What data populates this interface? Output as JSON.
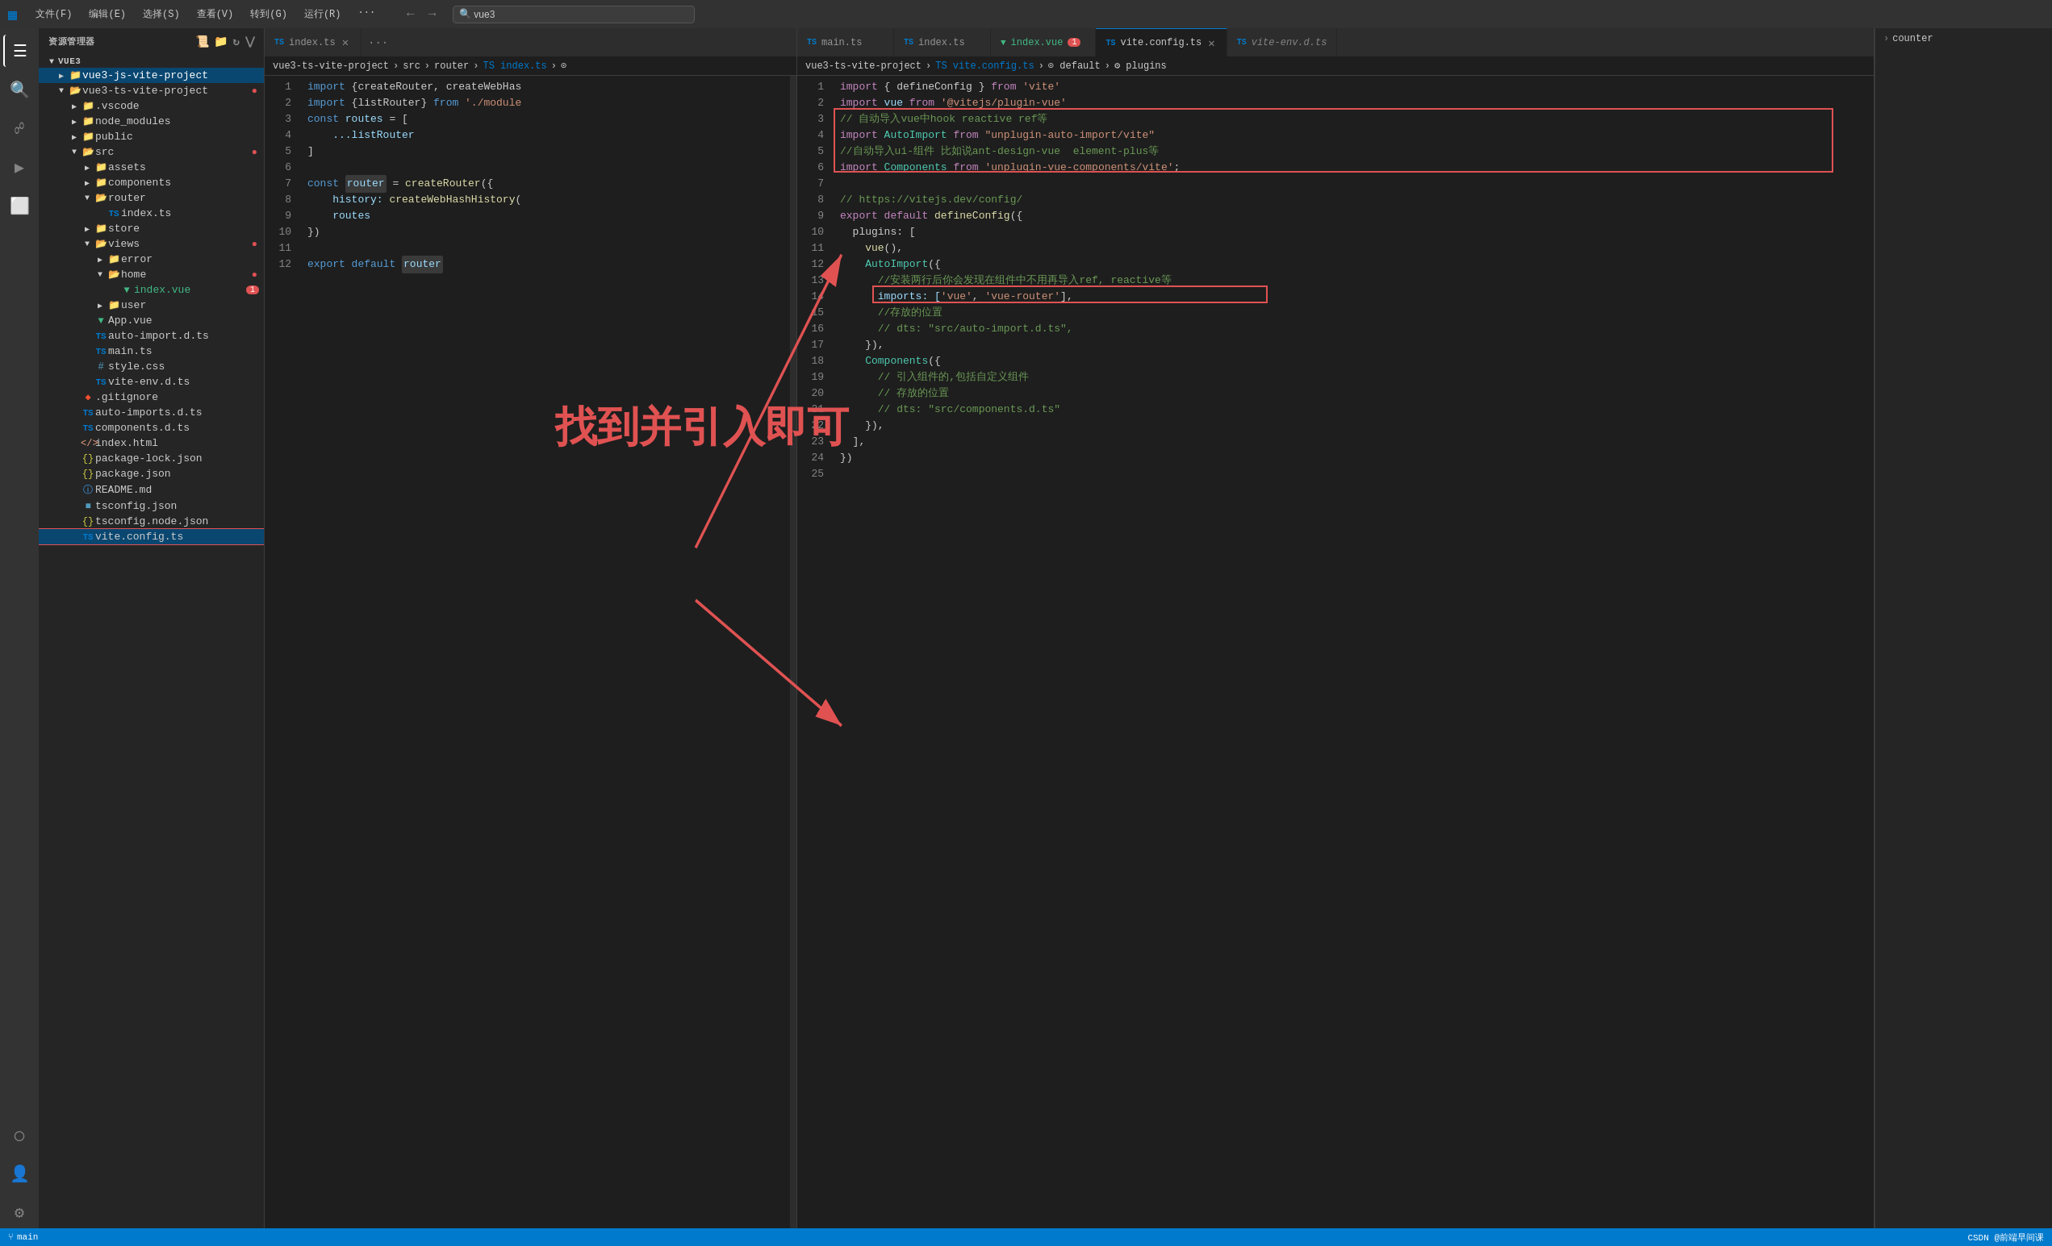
{
  "titlebar": {
    "icon": "VS",
    "menus": [
      "文件(F)",
      "编辑(E)",
      "选择(S)",
      "查看(V)",
      "转到(G)",
      "运行(R)",
      "···"
    ],
    "search_placeholder": "vue3",
    "nav_back": "←",
    "nav_forward": "→"
  },
  "activity": {
    "items": [
      "explorer",
      "search",
      "git",
      "debug",
      "extensions",
      "remote",
      "account",
      "settings"
    ]
  },
  "sidebar": {
    "title": "资源管理器",
    "icons": [
      "new-file",
      "new-folder",
      "refresh",
      "collapse"
    ],
    "root": "VUE3",
    "tree": [
      {
        "level": 1,
        "type": "folder",
        "open": true,
        "label": "vue3-js-vite-project",
        "selected": true
      },
      {
        "level": 1,
        "type": "folder",
        "open": true,
        "label": "vue3-ts-vite-project",
        "badge": "dot"
      },
      {
        "level": 2,
        "type": "folder",
        "open": false,
        "label": ".vscode"
      },
      {
        "level": 2,
        "type": "folder",
        "open": false,
        "label": "node_modules"
      },
      {
        "level": 2,
        "type": "folder",
        "open": false,
        "label": "public"
      },
      {
        "level": 2,
        "type": "folder",
        "open": true,
        "label": "src",
        "badge": "dot"
      },
      {
        "level": 3,
        "type": "folder",
        "open": false,
        "label": "assets"
      },
      {
        "level": 3,
        "type": "folder",
        "open": false,
        "label": "components"
      },
      {
        "level": 3,
        "type": "folder",
        "open": true,
        "label": "router"
      },
      {
        "level": 4,
        "type": "ts",
        "label": "index.ts"
      },
      {
        "level": 3,
        "type": "folder",
        "open": false,
        "label": "store"
      },
      {
        "level": 3,
        "type": "folder",
        "open": true,
        "label": "views",
        "badge": "dot"
      },
      {
        "level": 4,
        "type": "folder",
        "open": false,
        "label": "error"
      },
      {
        "level": 4,
        "type": "folder",
        "open": true,
        "label": "home",
        "badge": "dot"
      },
      {
        "level": 5,
        "type": "vue",
        "label": "index.vue",
        "badge_num": "1"
      },
      {
        "level": 4,
        "type": "folder",
        "open": false,
        "label": "user"
      },
      {
        "level": 3,
        "type": "vue",
        "label": "App.vue"
      },
      {
        "level": 3,
        "type": "ts",
        "label": "auto-import.d.ts"
      },
      {
        "level": 3,
        "type": "ts",
        "label": "main.ts"
      },
      {
        "level": 3,
        "type": "css",
        "label": "style.css"
      },
      {
        "level": 3,
        "type": "ts",
        "label": "vite-env.d.ts"
      },
      {
        "level": 2,
        "type": "git",
        "label": ".gitignore"
      },
      {
        "level": 2,
        "type": "ts",
        "label": "auto-imports.d.ts"
      },
      {
        "level": 2,
        "type": "ts",
        "label": "components.d.ts"
      },
      {
        "level": 2,
        "type": "html",
        "label": "index.html"
      },
      {
        "level": 2,
        "type": "json",
        "label": "package-lock.json"
      },
      {
        "level": 2,
        "type": "json",
        "label": "package.json"
      },
      {
        "level": 2,
        "type": "md",
        "label": "README.md"
      },
      {
        "level": 2,
        "type": "json-blue",
        "label": "tsconfig.json"
      },
      {
        "level": 2,
        "type": "json",
        "label": "tsconfig.node.json"
      },
      {
        "level": 2,
        "type": "ts",
        "label": "vite.config.ts",
        "active": true
      }
    ]
  },
  "tabs_left": {
    "items": [
      {
        "icon": "ts",
        "label": "index.ts",
        "closable": true,
        "active": false
      },
      {
        "icon": "overflow",
        "label": "···"
      }
    ]
  },
  "breadcrumb_left": {
    "parts": [
      "vue3-ts-vite-project",
      ">",
      "src",
      ">",
      "router",
      ">",
      "TS index.ts",
      ">",
      "⊙"
    ]
  },
  "editor_left": {
    "lines": [
      {
        "num": 1,
        "tokens": [
          {
            "t": "import ",
            "c": "kw"
          },
          {
            "t": "{createRouter, createWebHas",
            "c": "punct"
          }
        ]
      },
      {
        "num": 2,
        "tokens": [
          {
            "t": "import ",
            "c": "kw"
          },
          {
            "t": "{listRouter} ",
            "c": "punct"
          },
          {
            "t": "from ",
            "c": "kw"
          },
          {
            "t": "'./module",
            "c": "str"
          }
        ]
      },
      {
        "num": 3,
        "tokens": [
          {
            "t": "const ",
            "c": "kw"
          },
          {
            "t": "routes ",
            "c": "var"
          },
          {
            "t": "= [",
            "c": "punct"
          }
        ]
      },
      {
        "num": 4,
        "tokens": [
          {
            "t": "    ...listRouter",
            "c": "var"
          }
        ]
      },
      {
        "num": 5,
        "tokens": [
          {
            "t": "]",
            "c": "punct"
          }
        ]
      },
      {
        "num": 6,
        "tokens": []
      },
      {
        "num": 7,
        "tokens": [
          {
            "t": "const ",
            "c": "kw"
          },
          {
            "t": "router",
            "c": "var",
            "highlight": true
          },
          {
            "t": " = ",
            "c": "punct"
          },
          {
            "t": "createRouter",
            "c": "fn"
          },
          {
            "t": "({",
            "c": "punct"
          }
        ]
      },
      {
        "num": 8,
        "tokens": [
          {
            "t": "    history: ",
            "c": "prop"
          },
          {
            "t": "createWebHashHistory",
            "c": "fn"
          },
          {
            "t": "(",
            "c": "punct"
          }
        ]
      },
      {
        "num": 9,
        "tokens": [
          {
            "t": "    routes",
            "c": "var"
          }
        ]
      },
      {
        "num": 10,
        "tokens": [
          {
            "t": "})",
            "c": "punct"
          }
        ]
      },
      {
        "num": 11,
        "tokens": []
      },
      {
        "num": 12,
        "tokens": [
          {
            "t": "export ",
            "c": "kw"
          },
          {
            "t": "default ",
            "c": "kw"
          },
          {
            "t": "router",
            "c": "var",
            "highlight": true
          }
        ]
      }
    ]
  },
  "tabs_right": {
    "items": [
      {
        "icon": "ts",
        "label": "main.ts",
        "active": false
      },
      {
        "icon": "ts",
        "label": "index.ts",
        "active": false
      },
      {
        "icon": "vue",
        "label": "index.vue",
        "active": false,
        "dot": true,
        "num": "1"
      },
      {
        "icon": "ts",
        "label": "vite.config.ts",
        "active": true,
        "closable": true
      },
      {
        "icon": "ts",
        "label": "vite-env.d.ts",
        "active": false
      }
    ]
  },
  "breadcrumb_right": {
    "parts": [
      "vue3-ts-vite-project",
      ">",
      "TS vite.config.ts",
      ">",
      "⊙ default",
      ">",
      "⚙ plugins"
    ]
  },
  "editor_right": {
    "lines": [
      {
        "num": 1,
        "tokens": [
          {
            "t": "import ",
            "c": "import-kw"
          },
          {
            "t": "{ defineConfig } ",
            "c": "punct"
          },
          {
            "t": "from ",
            "c": "import-kw"
          },
          {
            "t": "'vite'",
            "c": "str"
          }
        ]
      },
      {
        "num": 2,
        "tokens": [
          {
            "t": "import ",
            "c": "import-kw"
          },
          {
            "t": "vue ",
            "c": "var"
          },
          {
            "t": "from ",
            "c": "import-kw"
          },
          {
            "t": "'@vitejs/plugin-vue'",
            "c": "str"
          }
        ]
      },
      {
        "num": 3,
        "tokens": [
          {
            "t": "// 自动导入vue中hook reactive ref等",
            "c": "cm"
          }
        ],
        "redbox": true
      },
      {
        "num": 4,
        "tokens": [
          {
            "t": "import ",
            "c": "import-kw"
          },
          {
            "t": "AutoImport ",
            "c": "cls"
          },
          {
            "t": "from ",
            "c": "import-kw"
          },
          {
            "t": "\"unplugin-auto-import/vite\"",
            "c": "str"
          }
        ],
        "redbox": true
      },
      {
        "num": 5,
        "tokens": [
          {
            "t": "//自动导入ui-组件 比如说ant-design-vue  element-plus等",
            "c": "cm"
          }
        ],
        "redbox": true
      },
      {
        "num": 6,
        "tokens": [
          {
            "t": "import ",
            "c": "import-kw"
          },
          {
            "t": "Components ",
            "c": "cls"
          },
          {
            "t": "from ",
            "c": "import-kw"
          },
          {
            "t": "'unplugin-vue-components/vite'",
            "c": "str"
          },
          {
            "t": ";",
            "c": "punct"
          }
        ],
        "redbox": true
      },
      {
        "num": 7,
        "tokens": []
      },
      {
        "num": 8,
        "tokens": [
          {
            "t": "// https://vitejs.dev/config/",
            "c": "cm"
          }
        ]
      },
      {
        "num": 9,
        "tokens": [
          {
            "t": "export ",
            "c": "import-kw"
          },
          {
            "t": "default ",
            "c": "import-kw"
          },
          {
            "t": "defineConfig",
            "c": "fn"
          },
          {
            "t": "({",
            "c": "punct"
          }
        ]
      },
      {
        "num": 10,
        "tokens": [
          {
            "t": "  plugins: [",
            "c": "punct"
          }
        ]
      },
      {
        "num": 11,
        "tokens": [
          {
            "t": "    vue",
            "c": "fn"
          },
          {
            "t": "(),",
            "c": "punct"
          }
        ]
      },
      {
        "num": 12,
        "tokens": [
          {
            "t": "    AutoImport",
            "c": "cls"
          },
          {
            "t": "({",
            "c": "punct"
          }
        ]
      },
      {
        "num": 13,
        "tokens": [
          {
            "t": "      //安装两行后你会发现在组件中不用再导入ref, reactive等",
            "c": "cm"
          }
        ]
      },
      {
        "num": 14,
        "tokens": [
          {
            "t": "      imports: [",
            "c": "prop"
          },
          {
            "t": "'vue'",
            "c": "str"
          },
          {
            "t": ", ",
            "c": "punct"
          },
          {
            "t": "'vue-router'",
            "c": "str"
          },
          {
            "t": "],",
            "c": "punct"
          }
        ],
        "redbox2": true
      },
      {
        "num": 15,
        "tokens": [
          {
            "t": "      //存放的位置",
            "c": "cm"
          }
        ]
      },
      {
        "num": 16,
        "tokens": [
          {
            "t": "      // dts: \"src/auto-import.d.ts\",",
            "c": "cm"
          }
        ]
      },
      {
        "num": 17,
        "tokens": [
          {
            "t": "    }),",
            "c": "punct"
          }
        ]
      },
      {
        "num": 18,
        "tokens": [
          {
            "t": "    Components",
            "c": "cls"
          },
          {
            "t": "({",
            "c": "punct"
          }
        ]
      },
      {
        "num": 19,
        "tokens": [
          {
            "t": "      // 引入组件的,包括自定义组件",
            "c": "cm"
          }
        ]
      },
      {
        "num": 20,
        "tokens": [
          {
            "t": "      // 存放的位置",
            "c": "cm"
          }
        ]
      },
      {
        "num": 21,
        "tokens": [
          {
            "t": "      // dts: \"src/components.d.ts\"",
            "c": "cm"
          }
        ]
      },
      {
        "num": 22,
        "tokens": [
          {
            "t": "    }),",
            "c": "punct"
          }
        ]
      },
      {
        "num": 23,
        "tokens": [
          {
            "t": "  ],",
            "c": "punct"
          }
        ]
      },
      {
        "num": 24,
        "tokens": [
          {
            "t": "})",
            "c": "punct"
          }
        ]
      },
      {
        "num": 25,
        "tokens": []
      }
    ]
  },
  "right_panel": {
    "arrow": ">",
    "label": "counter"
  },
  "annotation": {
    "text": "找到并引入即可"
  },
  "status_bar": {
    "right_text": "CSDN @前端早间课"
  }
}
